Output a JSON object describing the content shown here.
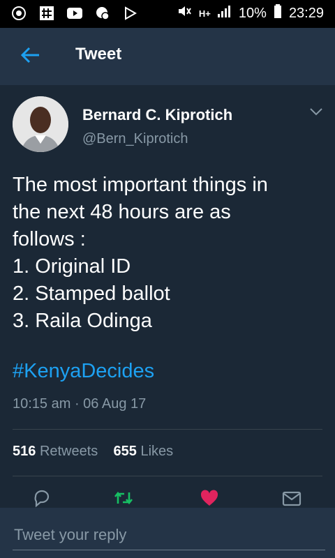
{
  "status_bar": {
    "battery": "10%",
    "time": "23:29",
    "network": "H+"
  },
  "header": {
    "title": "Tweet"
  },
  "tweet": {
    "author_name": "Bernard C. Kiprotich",
    "author_handle": "@Bern_Kiprotich",
    "text_lines": [
      "The most important things in",
      "the next 48 hours are as",
      "follows :",
      "1. Original ID",
      "2. Stamped ballot",
      "3. Raila Odinga"
    ],
    "hashtag": "#KenyaDecides",
    "timestamp": "10:15 am · 06 Aug 17",
    "retweets_count": "516",
    "retweets_label": "Retweets",
    "likes_count": "655",
    "likes_label": "Likes"
  },
  "reply": {
    "placeholder": "Tweet your reply"
  },
  "colors": {
    "background": "#1b2836",
    "bar": "#243447",
    "accent": "#1da1f2",
    "secondary_text": "#8899a6",
    "retweet": "#17bf63",
    "like": "#e0245e"
  }
}
